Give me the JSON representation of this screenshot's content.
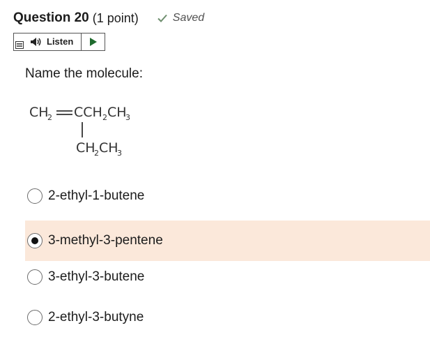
{
  "question": {
    "title": "Question 20",
    "points": "(1 point)",
    "status": "Saved",
    "status_icon": "checkmark-icon"
  },
  "listen": {
    "label": "Listen",
    "icons": [
      "menu-icon",
      "speaker-icon",
      "play-icon"
    ]
  },
  "prompt": "Name the molecule:",
  "molecule": {
    "top_main": "CH",
    "top_sub1": "2",
    "top_mid": "CCH",
    "top_sub2": "2",
    "top_end": "CH",
    "top_sub3": "3",
    "bottom_main1": "CH",
    "bottom_sub1": "2",
    "bottom_main2": "CH",
    "bottom_sub2": "3"
  },
  "options": [
    {
      "label": "2-ethyl-1-butene",
      "selected": false
    },
    {
      "label": "3-methyl-3-pentene",
      "selected": true
    },
    {
      "label": "3-ethyl-3-butene",
      "selected": false
    },
    {
      "label": "2-ethyl-3-butyne",
      "selected": false
    }
  ],
  "colors": {
    "selected_background": "#fbe8da",
    "saved_check": "#6f8f6f"
  }
}
